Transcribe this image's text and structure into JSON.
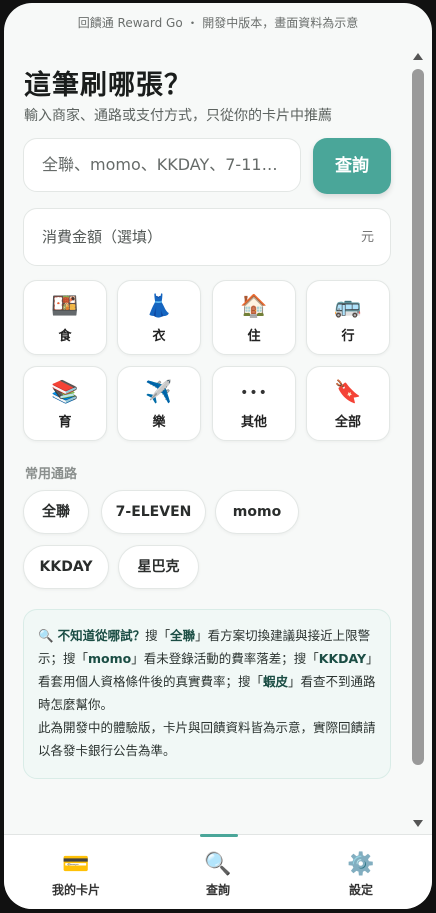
{
  "banner": "回饋通 Reward Go ・ 開發中版本，畫面資料為示意",
  "header": {
    "title": "這筆刷哪張？",
    "subtitle": "輸入商家、通路或支付方式，只從你的卡片中推薦"
  },
  "search": {
    "placeholder": "全聯、momo、KKDAY、7-11…",
    "button_label": "查詢"
  },
  "amount": {
    "placeholder": "消費金額（選填）",
    "unit": "元"
  },
  "categories": [
    {
      "label": "食",
      "icon": "🍱"
    },
    {
      "label": "衣",
      "icon": "👗"
    },
    {
      "label": "住",
      "icon": "🏠"
    },
    {
      "label": "行",
      "icon": "🚌"
    },
    {
      "label": "育",
      "icon": "📚"
    },
    {
      "label": "樂",
      "icon": "✈️"
    },
    {
      "label": "其他",
      "icon": "•••"
    },
    {
      "label": "全部",
      "icon": "🔖"
    }
  ],
  "common_channels": {
    "label": "常用通路",
    "items": [
      "全聯",
      "7-ELEVEN",
      "momo",
      "KKDAY",
      "星巴克"
    ]
  },
  "tip": {
    "icon": "🔍",
    "q": "不知道從哪試？",
    "t1": "搜「",
    "k1": "全聯",
    "t2": "」看方案切換建議與接近上限警示；搜「",
    "k2": "momo",
    "t3": "」看未登錄活動的費率落差；搜「",
    "k3": "KKDAY",
    "t4": "」看套用個人資格條件後的真實費率；搜「",
    "k4": "蝦皮",
    "t5": "」看查不到通路時怎麼幫你。",
    "note": "此為開發中的體驗版，卡片與回饋資料皆為示意，實際回饋請以各發卡銀行公告為準。"
  },
  "tabs": [
    {
      "label": "我的卡片",
      "icon": "💳"
    },
    {
      "label": "查詢",
      "icon": "🔍"
    },
    {
      "label": "設定",
      "icon": "⚙️"
    }
  ],
  "colors": {
    "accent": "#4aa699"
  }
}
